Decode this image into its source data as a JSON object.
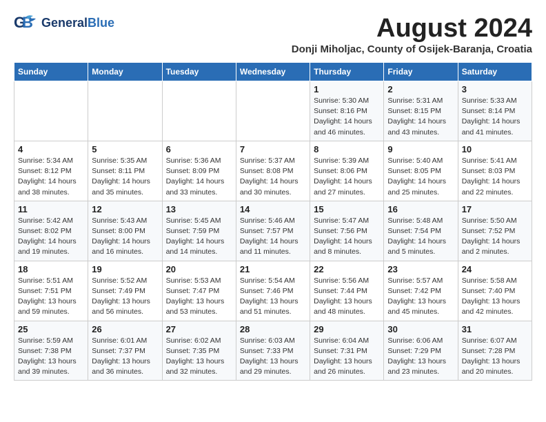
{
  "header": {
    "logo_general": "General",
    "logo_blue": "Blue",
    "month_title": "August 2024",
    "location": "Donji Miholjac, County of Osijek-Baranja, Croatia"
  },
  "weekdays": [
    "Sunday",
    "Monday",
    "Tuesday",
    "Wednesday",
    "Thursday",
    "Friday",
    "Saturday"
  ],
  "weeks": [
    [
      {
        "day": "",
        "detail": ""
      },
      {
        "day": "",
        "detail": ""
      },
      {
        "day": "",
        "detail": ""
      },
      {
        "day": "",
        "detail": ""
      },
      {
        "day": "1",
        "detail": "Sunrise: 5:30 AM\nSunset: 8:16 PM\nDaylight: 14 hours\nand 46 minutes."
      },
      {
        "day": "2",
        "detail": "Sunrise: 5:31 AM\nSunset: 8:15 PM\nDaylight: 14 hours\nand 43 minutes."
      },
      {
        "day": "3",
        "detail": "Sunrise: 5:33 AM\nSunset: 8:14 PM\nDaylight: 14 hours\nand 41 minutes."
      }
    ],
    [
      {
        "day": "4",
        "detail": "Sunrise: 5:34 AM\nSunset: 8:12 PM\nDaylight: 14 hours\nand 38 minutes."
      },
      {
        "day": "5",
        "detail": "Sunrise: 5:35 AM\nSunset: 8:11 PM\nDaylight: 14 hours\nand 35 minutes."
      },
      {
        "day": "6",
        "detail": "Sunrise: 5:36 AM\nSunset: 8:09 PM\nDaylight: 14 hours\nand 33 minutes."
      },
      {
        "day": "7",
        "detail": "Sunrise: 5:37 AM\nSunset: 8:08 PM\nDaylight: 14 hours\nand 30 minutes."
      },
      {
        "day": "8",
        "detail": "Sunrise: 5:39 AM\nSunset: 8:06 PM\nDaylight: 14 hours\nand 27 minutes."
      },
      {
        "day": "9",
        "detail": "Sunrise: 5:40 AM\nSunset: 8:05 PM\nDaylight: 14 hours\nand 25 minutes."
      },
      {
        "day": "10",
        "detail": "Sunrise: 5:41 AM\nSunset: 8:03 PM\nDaylight: 14 hours\nand 22 minutes."
      }
    ],
    [
      {
        "day": "11",
        "detail": "Sunrise: 5:42 AM\nSunset: 8:02 PM\nDaylight: 14 hours\nand 19 minutes."
      },
      {
        "day": "12",
        "detail": "Sunrise: 5:43 AM\nSunset: 8:00 PM\nDaylight: 14 hours\nand 16 minutes."
      },
      {
        "day": "13",
        "detail": "Sunrise: 5:45 AM\nSunset: 7:59 PM\nDaylight: 14 hours\nand 14 minutes."
      },
      {
        "day": "14",
        "detail": "Sunrise: 5:46 AM\nSunset: 7:57 PM\nDaylight: 14 hours\nand 11 minutes."
      },
      {
        "day": "15",
        "detail": "Sunrise: 5:47 AM\nSunset: 7:56 PM\nDaylight: 14 hours\nand 8 minutes."
      },
      {
        "day": "16",
        "detail": "Sunrise: 5:48 AM\nSunset: 7:54 PM\nDaylight: 14 hours\nand 5 minutes."
      },
      {
        "day": "17",
        "detail": "Sunrise: 5:50 AM\nSunset: 7:52 PM\nDaylight: 14 hours\nand 2 minutes."
      }
    ],
    [
      {
        "day": "18",
        "detail": "Sunrise: 5:51 AM\nSunset: 7:51 PM\nDaylight: 13 hours\nand 59 minutes."
      },
      {
        "day": "19",
        "detail": "Sunrise: 5:52 AM\nSunset: 7:49 PM\nDaylight: 13 hours\nand 56 minutes."
      },
      {
        "day": "20",
        "detail": "Sunrise: 5:53 AM\nSunset: 7:47 PM\nDaylight: 13 hours\nand 53 minutes."
      },
      {
        "day": "21",
        "detail": "Sunrise: 5:54 AM\nSunset: 7:46 PM\nDaylight: 13 hours\nand 51 minutes."
      },
      {
        "day": "22",
        "detail": "Sunrise: 5:56 AM\nSunset: 7:44 PM\nDaylight: 13 hours\nand 48 minutes."
      },
      {
        "day": "23",
        "detail": "Sunrise: 5:57 AM\nSunset: 7:42 PM\nDaylight: 13 hours\nand 45 minutes."
      },
      {
        "day": "24",
        "detail": "Sunrise: 5:58 AM\nSunset: 7:40 PM\nDaylight: 13 hours\nand 42 minutes."
      }
    ],
    [
      {
        "day": "25",
        "detail": "Sunrise: 5:59 AM\nSunset: 7:38 PM\nDaylight: 13 hours\nand 39 minutes."
      },
      {
        "day": "26",
        "detail": "Sunrise: 6:01 AM\nSunset: 7:37 PM\nDaylight: 13 hours\nand 36 minutes."
      },
      {
        "day": "27",
        "detail": "Sunrise: 6:02 AM\nSunset: 7:35 PM\nDaylight: 13 hours\nand 32 minutes."
      },
      {
        "day": "28",
        "detail": "Sunrise: 6:03 AM\nSunset: 7:33 PM\nDaylight: 13 hours\nand 29 minutes."
      },
      {
        "day": "29",
        "detail": "Sunrise: 6:04 AM\nSunset: 7:31 PM\nDaylight: 13 hours\nand 26 minutes."
      },
      {
        "day": "30",
        "detail": "Sunrise: 6:06 AM\nSunset: 7:29 PM\nDaylight: 13 hours\nand 23 minutes."
      },
      {
        "day": "31",
        "detail": "Sunrise: 6:07 AM\nSunset: 7:28 PM\nDaylight: 13 hours\nand 20 minutes."
      }
    ]
  ]
}
